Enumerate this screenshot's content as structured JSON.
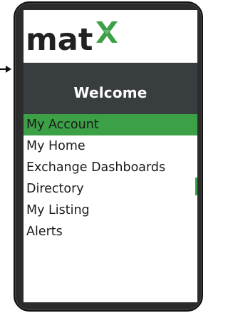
{
  "app": {
    "logo_text": "mat",
    "logo_mark": "X",
    "brand_color": "#3ca046"
  },
  "header": {
    "title": "Welcome",
    "background_color": "#383d3f"
  },
  "menu": {
    "items": [
      {
        "label": "My Account",
        "active": true
      },
      {
        "label": "My Home",
        "active": false
      },
      {
        "label": "Exchange Dashboards",
        "active": false
      },
      {
        "label": "Directory",
        "active": false
      },
      {
        "label": "My Listing",
        "active": false
      },
      {
        "label": "Alerts",
        "active": false
      }
    ]
  },
  "icons": {
    "pointer": "arrow-right-icon",
    "logo_mark": "x-mark-icon"
  }
}
